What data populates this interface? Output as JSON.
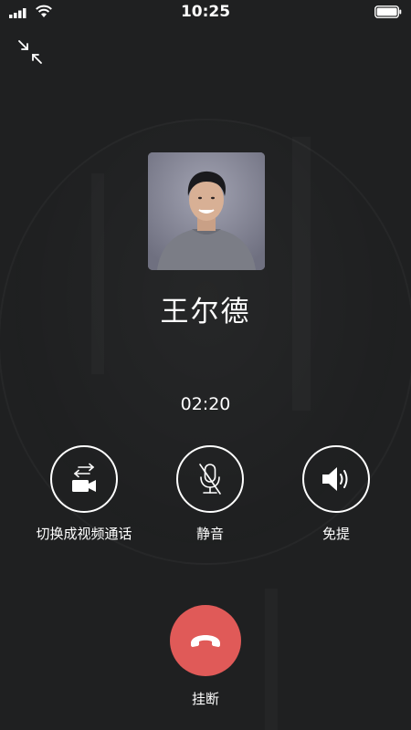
{
  "status_bar": {
    "time": "10:25",
    "signal_icon": "cellular-signal-icon",
    "wifi_icon": "wifi-icon",
    "battery_icon": "battery-icon"
  },
  "call": {
    "caller_name": "王尔德",
    "duration": "02:20",
    "minimize_icon": "minimize-icon"
  },
  "controls": [
    {
      "label": "切换成视频通话",
      "icon": "video-switch-icon"
    },
    {
      "label": "静音",
      "icon": "mic-muted-icon"
    },
    {
      "label": "免提",
      "icon": "speaker-icon"
    }
  ],
  "hangup": {
    "label": "挂断",
    "icon": "phone-hangup-icon",
    "color": "#e05a58"
  },
  "colors": {
    "background": "#1f2021",
    "foreground": "#ffffff"
  }
}
